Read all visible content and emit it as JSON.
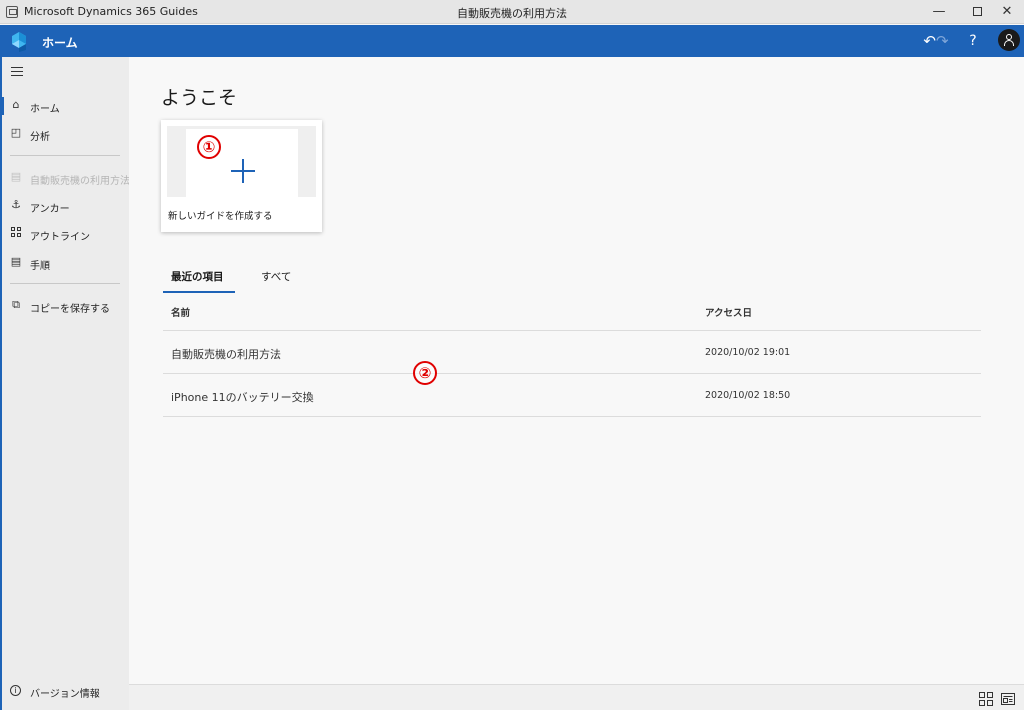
{
  "window": {
    "app_name": "Microsoft Dynamics 365 Guides",
    "doc_title": "自動販売機の利用方法",
    "minimize": "—",
    "close": "✕"
  },
  "header": {
    "page_label": "ホーム",
    "undo": "↶",
    "redo": "↷",
    "help": "?"
  },
  "sidebar": {
    "items": [
      {
        "label": "ホーム",
        "icon": "home-icon",
        "glyph": "⌂"
      },
      {
        "label": "分析",
        "icon": "analytics-icon",
        "glyph": "◰"
      },
      {
        "label": "自動販売機の利用方法",
        "icon": "guide-icon",
        "glyph": "▤"
      },
      {
        "label": "アンカー",
        "icon": "anchor-icon",
        "glyph": "⚓"
      },
      {
        "label": "アウトライン",
        "icon": "outline-icon",
        "glyph": ""
      },
      {
        "label": "手順",
        "icon": "step-icon",
        "glyph": "▤"
      },
      {
        "label": "コピーを保存する",
        "icon": "save-copy-icon",
        "glyph": "⧉"
      }
    ],
    "version_label": "バージョン情報",
    "version_glyph": "i"
  },
  "main": {
    "welcome": "ようこそ",
    "new_guide_label": "新しいガイドを作成する",
    "annotations": [
      "①",
      "②"
    ],
    "tabs": [
      {
        "label": "最近の項目",
        "active": true
      },
      {
        "label": "すべて",
        "active": false
      }
    ],
    "table": {
      "columns": [
        "名前",
        "アクセス日"
      ],
      "rows": [
        {
          "name": "自動販売機の利用方法",
          "date": "2020/10/02 19:01"
        },
        {
          "name": "iPhone 11のバッテリー交換",
          "date": "2020/10/02 18:50"
        }
      ]
    }
  },
  "colors": {
    "accent": "#1e63b7",
    "annotation": "#e00000"
  }
}
